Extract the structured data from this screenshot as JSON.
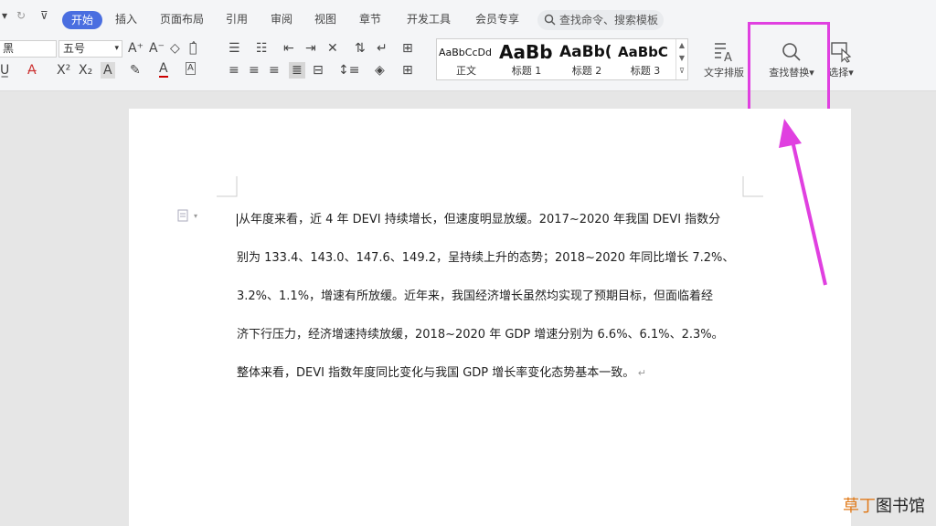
{
  "menu": {
    "tabs": [
      "开始",
      "插入",
      "页面布局",
      "引用",
      "审阅",
      "视图",
      "章节",
      "开发工具",
      "会员专享"
    ],
    "search_placeholder": "查找命令、搜索模板"
  },
  "ribbon": {
    "font_name": "黑",
    "font_size": "五号",
    "styles": [
      {
        "sample": "AaBbCcDd",
        "name": "正文"
      },
      {
        "sample": "AaBb",
        "name": "标题 1"
      },
      {
        "sample": "AaBb(",
        "name": "标题 2"
      },
      {
        "sample": "AaBbC",
        "name": "标题 3"
      }
    ],
    "text_layout_label": "文字排版",
    "find_replace_label": "查找替换",
    "select_label": "选择"
  },
  "document": {
    "lines": [
      "从年度来看，近 4 年 DEVI 持续增长，但速度明显放缓。2017~2020 年我国 DEVI 指数分",
      "别为 133.4、143.0、147.6、149.2，呈持续上升的态势；2018~2020 年同比增长 7.2%、",
      "3.2%、1.1%，增速有所放缓。近年来，我国经济增长虽然均实现了预期目标，但面临着经",
      "济下行压力，经济增速持续放缓，2018~2020 年 GDP 增速分别为 6.6%、6.1%、2.3%。",
      "整体来看，DEVI 指数年度同比变化与我国 GDP 增长率变化态势基本一致。"
    ]
  },
  "watermark": {
    "part1": "草丁",
    "part2": "图书馆"
  },
  "colors": {
    "accent": "#4a6ee0",
    "highlight": "#e040e0"
  }
}
